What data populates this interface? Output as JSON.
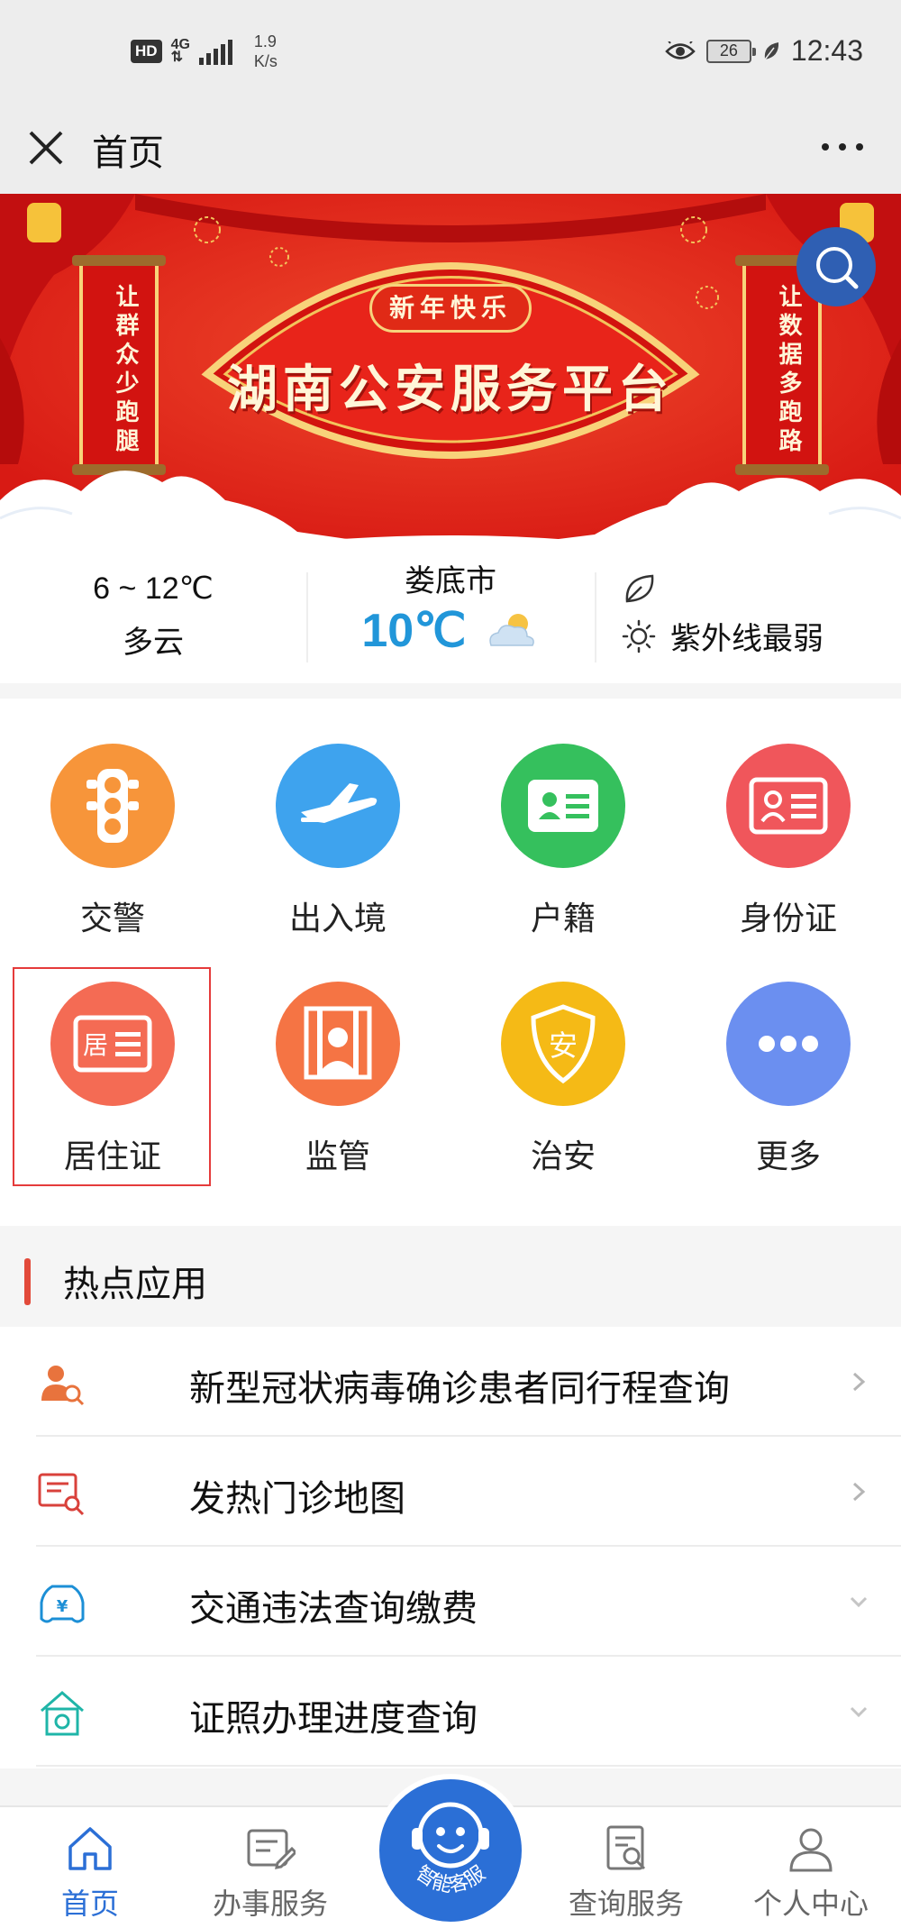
{
  "status_bar": {
    "hd": "HD",
    "network_top": "4G",
    "network_bottom": "⇅",
    "speed_value": "1.9",
    "speed_unit": "K/s",
    "battery": "26",
    "time": "12:43"
  },
  "title_bar": {
    "title": "首页"
  },
  "banner": {
    "subtitle": "新年快乐",
    "title": "湖南公安服务平台",
    "left_scroll": "让群众少跑腿",
    "right_scroll": "让数据多跑路"
  },
  "weather": {
    "temp_range": "6 ~ 12℃",
    "condition": "多云",
    "city": "娄底市",
    "current_temp": "10℃",
    "uv": "紫外线最弱"
  },
  "services": [
    {
      "label": "交警",
      "color": "#f7953a",
      "icon": "traffic-light-icon"
    },
    {
      "label": "出入境",
      "color": "#3ea3ee",
      "icon": "airplane-icon"
    },
    {
      "label": "户籍",
      "color": "#35c05d",
      "icon": "household-card-icon"
    },
    {
      "label": "身份证",
      "color": "#f0565b",
      "icon": "id-card-icon"
    },
    {
      "label": "居住证",
      "color": "#f46b54",
      "icon": "residence-permit-icon"
    },
    {
      "label": "监管",
      "color": "#f57444",
      "icon": "prison-icon"
    },
    {
      "label": "治安",
      "color": "#f5ba16",
      "icon": "shield-icon"
    },
    {
      "label": "更多",
      "color": "#6b8ff0",
      "icon": "more-icon"
    }
  ],
  "hot_apps": {
    "title": "热点应用",
    "items": [
      {
        "label": "新型冠状病毒确诊患者同行程查询",
        "icon": "person-search-icon",
        "chevron": "right"
      },
      {
        "label": "发热门诊地图",
        "icon": "clinic-map-icon",
        "chevron": "right"
      },
      {
        "label": "交通违法查询缴费",
        "icon": "car-fine-icon",
        "chevron": "down"
      },
      {
        "label": "证照办理进度查询",
        "icon": "house-progress-icon",
        "chevron": "down"
      }
    ]
  },
  "tab_bar": {
    "tabs": [
      {
        "label": "首页",
        "icon": "home-icon",
        "active": true
      },
      {
        "label": "办事服务",
        "icon": "service-icon",
        "active": false
      },
      {
        "label": "查询服务",
        "icon": "query-icon",
        "active": false
      },
      {
        "label": "个人中心",
        "icon": "user-icon",
        "active": false
      }
    ],
    "center_label": "智能客服"
  },
  "colors": {
    "accent": "#2b6fd6",
    "banner_red": "#e52b1f",
    "weather_blue": "#2196d9",
    "highlight": "#e53b3b"
  }
}
